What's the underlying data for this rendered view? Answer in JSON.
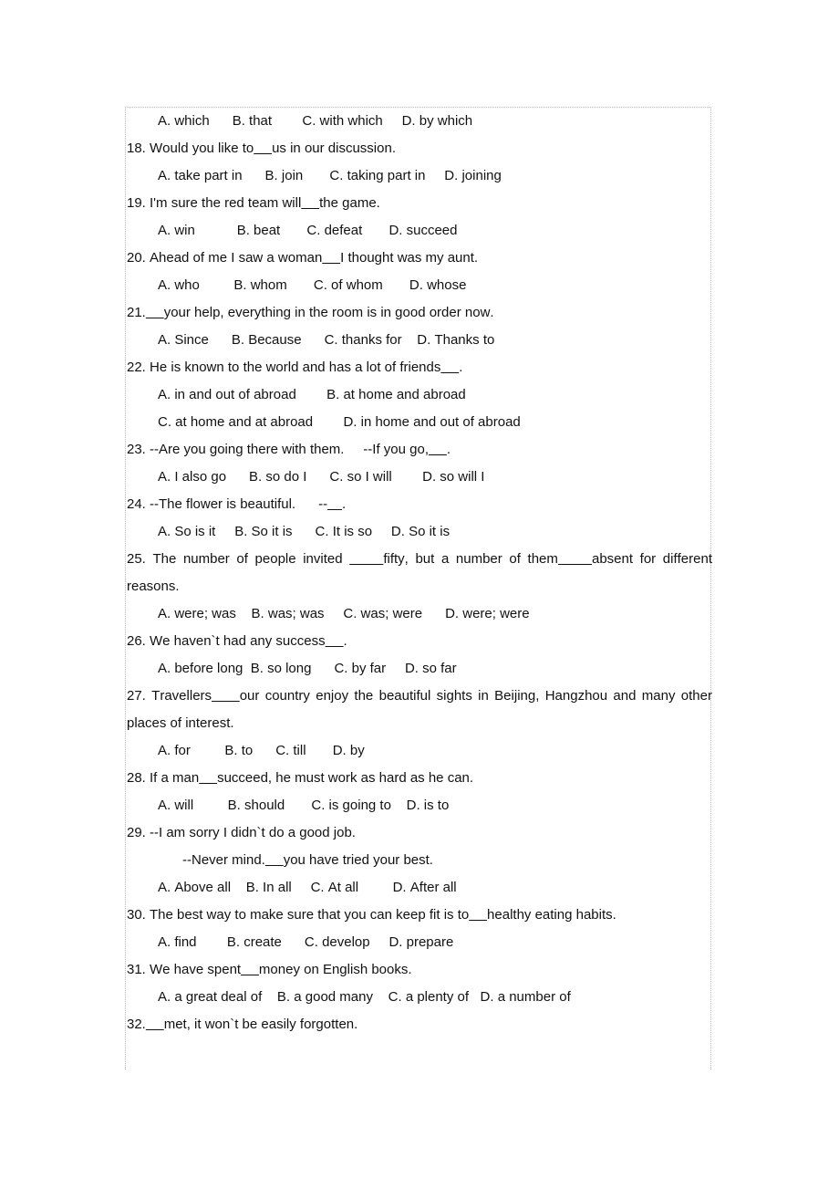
{
  "document": {
    "type": "english-grammar-multiple-choice-worksheet",
    "frame_color": "#b9b9b9"
  },
  "lines": [
    {
      "id": "q17-options",
      "kind": "options",
      "text": "A. which      B. that        C. with which     D. by which"
    },
    {
      "id": "q18-stem",
      "kind": "question",
      "text": "18. Would you like to_____us in our discussion."
    },
    {
      "id": "q18-options",
      "kind": "options",
      "text": "A. take part in      B. join       C. taking part in     D. joining"
    },
    {
      "id": "q19-stem",
      "kind": "question",
      "text": "19. I'm sure the red team will_____the game."
    },
    {
      "id": "q19-options",
      "kind": "options",
      "text": "A. win           B. beat       C. defeat       D. succeed"
    },
    {
      "id": "q20-stem",
      "kind": "question",
      "text": "20. Ahead of me I saw a woman_____I thought was my aunt."
    },
    {
      "id": "q20-options",
      "kind": "options",
      "text": "A. who         B. whom       C. of whom       D. whose"
    },
    {
      "id": "q21-stem",
      "kind": "question",
      "text": "21._____your help, everything in the room is in good order now."
    },
    {
      "id": "q21-options",
      "kind": "options",
      "text": "A. Since      B. Because      C. thanks for    D. Thanks to"
    },
    {
      "id": "q22-stem",
      "kind": "question",
      "text": "22. He is known to the world and has a lot of friends_____."
    },
    {
      "id": "q22-options-ab",
      "kind": "options",
      "text": "A. in and out of abroad        B. at home and abroad"
    },
    {
      "id": "q22-options-cd",
      "kind": "options",
      "text": "C. at home and at abroad        D. in home and out of abroad"
    },
    {
      "id": "q23-stem",
      "kind": "question",
      "text": "23. --Are you going there with them.     --If you go,_____."
    },
    {
      "id": "q23-options",
      "kind": "options",
      "text": "A. I also go      B. so do I      C. so I will        D. so will I"
    },
    {
      "id": "q24-stem",
      "kind": "question",
      "text": "24. --The flower is beautiful.      --____."
    },
    {
      "id": "q24-options",
      "kind": "options",
      "text": "A. So is it     B. So it is      C. It is so     D. So it is"
    },
    {
      "id": "q25-stem-line1",
      "kind": "question-justified",
      "text": "25. The number of people invited _____fifty, but a number of them_____absent for different"
    },
    {
      "id": "q25-stem-line2",
      "kind": "continuation",
      "text": "reasons."
    },
    {
      "id": "q25-options",
      "kind": "options",
      "text": "A. were; was    B. was; was     C. was; were      D. were; were"
    },
    {
      "id": "q26-stem",
      "kind": "question",
      "text": "26. We haven`t had any success_____."
    },
    {
      "id": "q26-options",
      "kind": "options",
      "text": "A. before long  B. so long      C. by far     D. so far"
    },
    {
      "id": "q27-stem-line1",
      "kind": "question-justified",
      "text": "27. Travellers_____our country enjoy the beautiful sights in Beijing, Hangzhou and many other"
    },
    {
      "id": "q27-stem-line2",
      "kind": "continuation",
      "text": "places of interest."
    },
    {
      "id": "q27-options",
      "kind": "options",
      "text": "A. for         B. to      C. till       D. by"
    },
    {
      "id": "q28-stem",
      "kind": "question",
      "text": "28. If a man_____succeed, he must work as hard as he can."
    },
    {
      "id": "q28-options",
      "kind": "options",
      "text": "A. will         B. should       C. is going to    D. is to"
    },
    {
      "id": "q29-stem",
      "kind": "question",
      "text": "29. --I am sorry I didn`t do a good job."
    },
    {
      "id": "q29-reply",
      "kind": "reply",
      "text": "--Never mind._____you have tried your best."
    },
    {
      "id": "q29-options",
      "kind": "options",
      "text": "A. Above all    B. In all     C. At all         D. After all"
    },
    {
      "id": "q30-stem",
      "kind": "question",
      "text": "30. The best way to make sure that you can keep fit is to_____healthy eating habits."
    },
    {
      "id": "q30-options",
      "kind": "options",
      "text": "A. find        B. create      C. develop     D. prepare"
    },
    {
      "id": "q31-stem",
      "kind": "question",
      "text": "31. We have spent_____money on English books."
    },
    {
      "id": "q31-options",
      "kind": "options",
      "text": "A. a great deal of    B. a good many    C. a plenty of   D. a number of"
    },
    {
      "id": "q32-stem",
      "kind": "question",
      "text": "32._____met, it won`t be easily forgotten."
    }
  ]
}
